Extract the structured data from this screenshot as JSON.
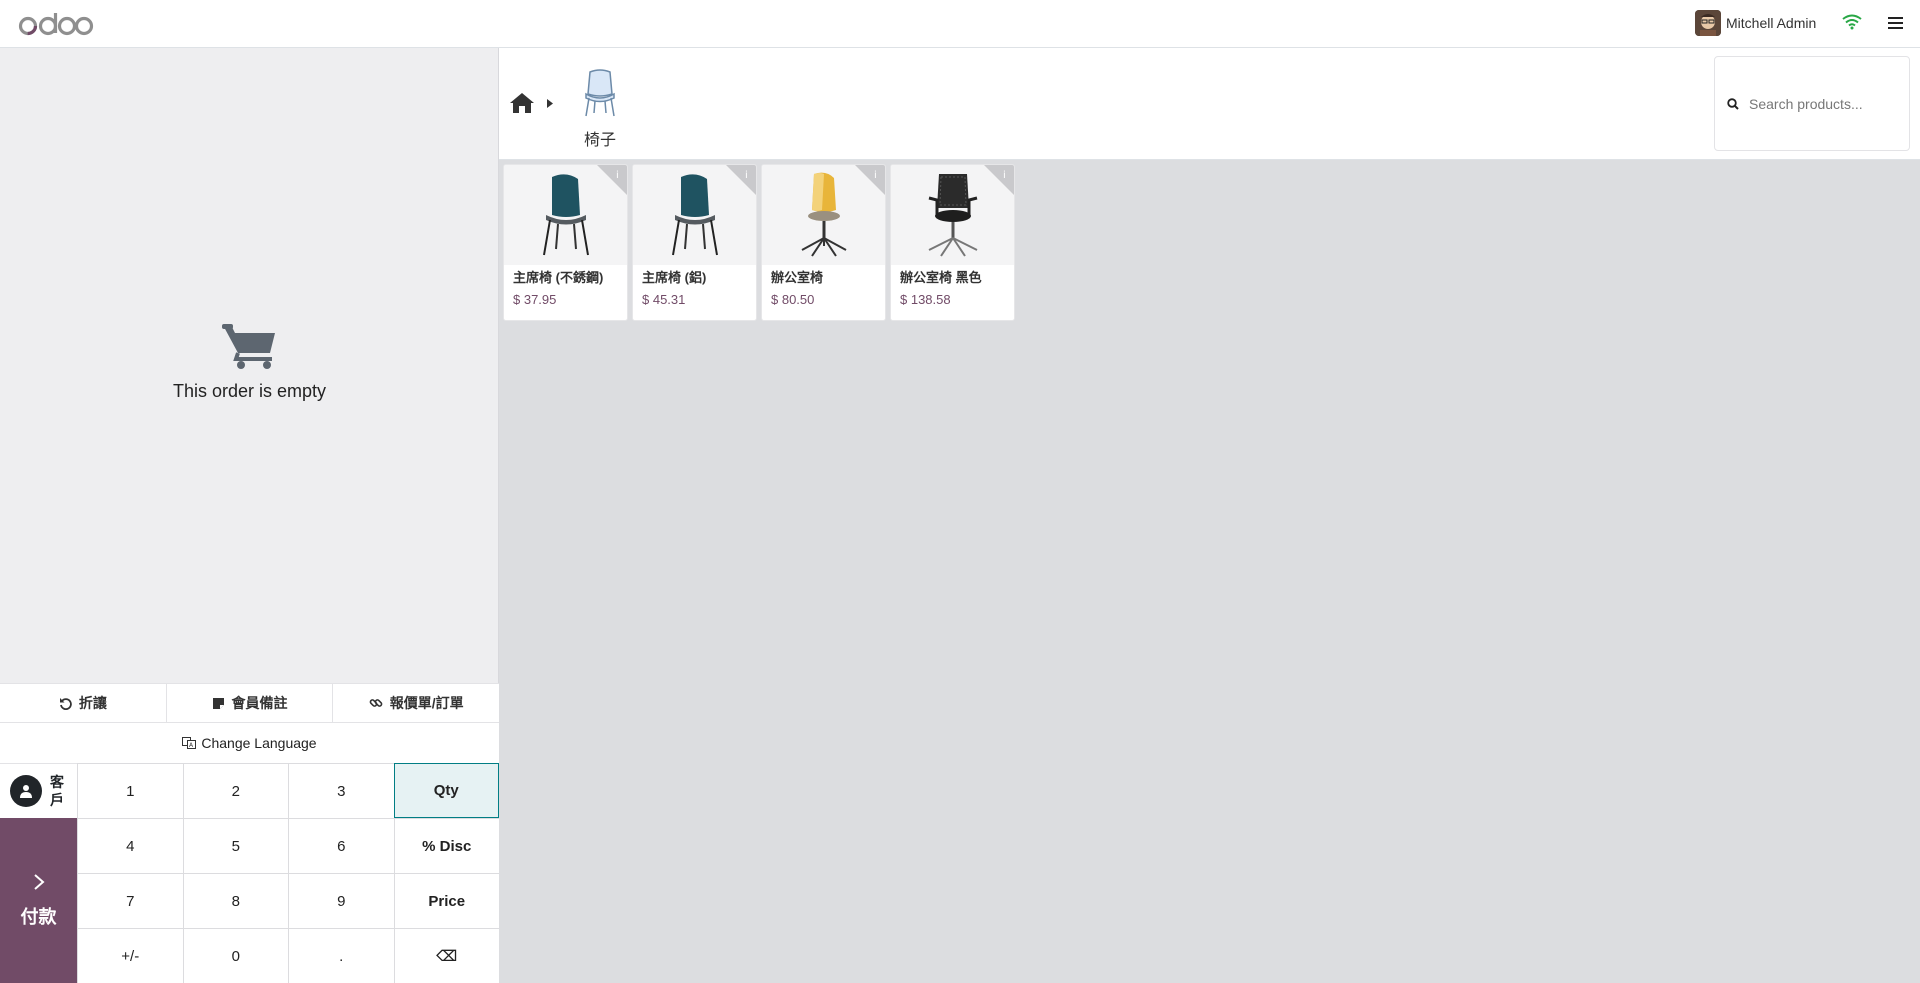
{
  "navbar": {
    "logo_text": "odoo",
    "user_name": "Mitchell Admin"
  },
  "order": {
    "empty_text": "This order is empty"
  },
  "controls": {
    "refund_label": "折讓",
    "note_label": "會員備註",
    "quotation_label": "報價單/訂單",
    "language_label": "Change Language"
  },
  "numpad": {
    "customer_label": "客戶",
    "payment_label": "付款",
    "keys": [
      "1",
      "2",
      "3",
      "Qty",
      "4",
      "5",
      "6",
      "% Disc",
      "7",
      "8",
      "9",
      "Price",
      "+/-",
      "0",
      ".",
      "⌫"
    ],
    "active_mode": "Qty"
  },
  "category": {
    "name": "椅子"
  },
  "search": {
    "placeholder": "Search products..."
  },
  "products": [
    {
      "name": "主席椅 (不銹鋼)",
      "price": "$ 37.95",
      "icon": "teal-chair-icon"
    },
    {
      "name": "主席椅 (鋁)",
      "price": "$ 45.31",
      "icon": "teal-chair-icon"
    },
    {
      "name": "辦公室椅",
      "price": "$ 80.50",
      "icon": "yellow-office-chair-icon"
    },
    {
      "name": "辦公室椅 黑色",
      "price": "$ 138.58",
      "icon": "black-office-chair-icon"
    }
  ],
  "colors": {
    "brand": "#714b67",
    "active_key_border": "#017e84",
    "wifi": "#28a745"
  }
}
